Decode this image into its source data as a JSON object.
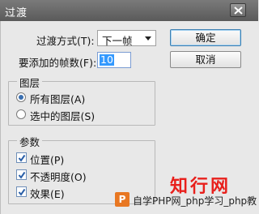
{
  "window": {
    "title": "过渡"
  },
  "form": {
    "transition_label": "过渡方式(T):",
    "transition_value": "下一帧",
    "frames_label": "要添加的帧数(F):",
    "frames_value": "10"
  },
  "buttons": {
    "ok": "确定",
    "cancel": "取消"
  },
  "layers_group": {
    "title": "图层",
    "options": [
      {
        "label": "所有图层(A)",
        "selected": true
      },
      {
        "label": "选中的图层(S)",
        "selected": false
      }
    ]
  },
  "params_group": {
    "title": "参数",
    "options": [
      {
        "label": "位置(P)",
        "checked": true
      },
      {
        "label": "不透明度(O)",
        "checked": true
      },
      {
        "label": "效果(E)",
        "checked": true
      }
    ]
  },
  "watermark": {
    "brand": "知行网",
    "logo": "P",
    "text": "自学PHP网_php学习_php教"
  },
  "icons": {
    "close": "close-icon",
    "dropdown": "chevron-down-icon",
    "check": "checkmark-icon"
  }
}
